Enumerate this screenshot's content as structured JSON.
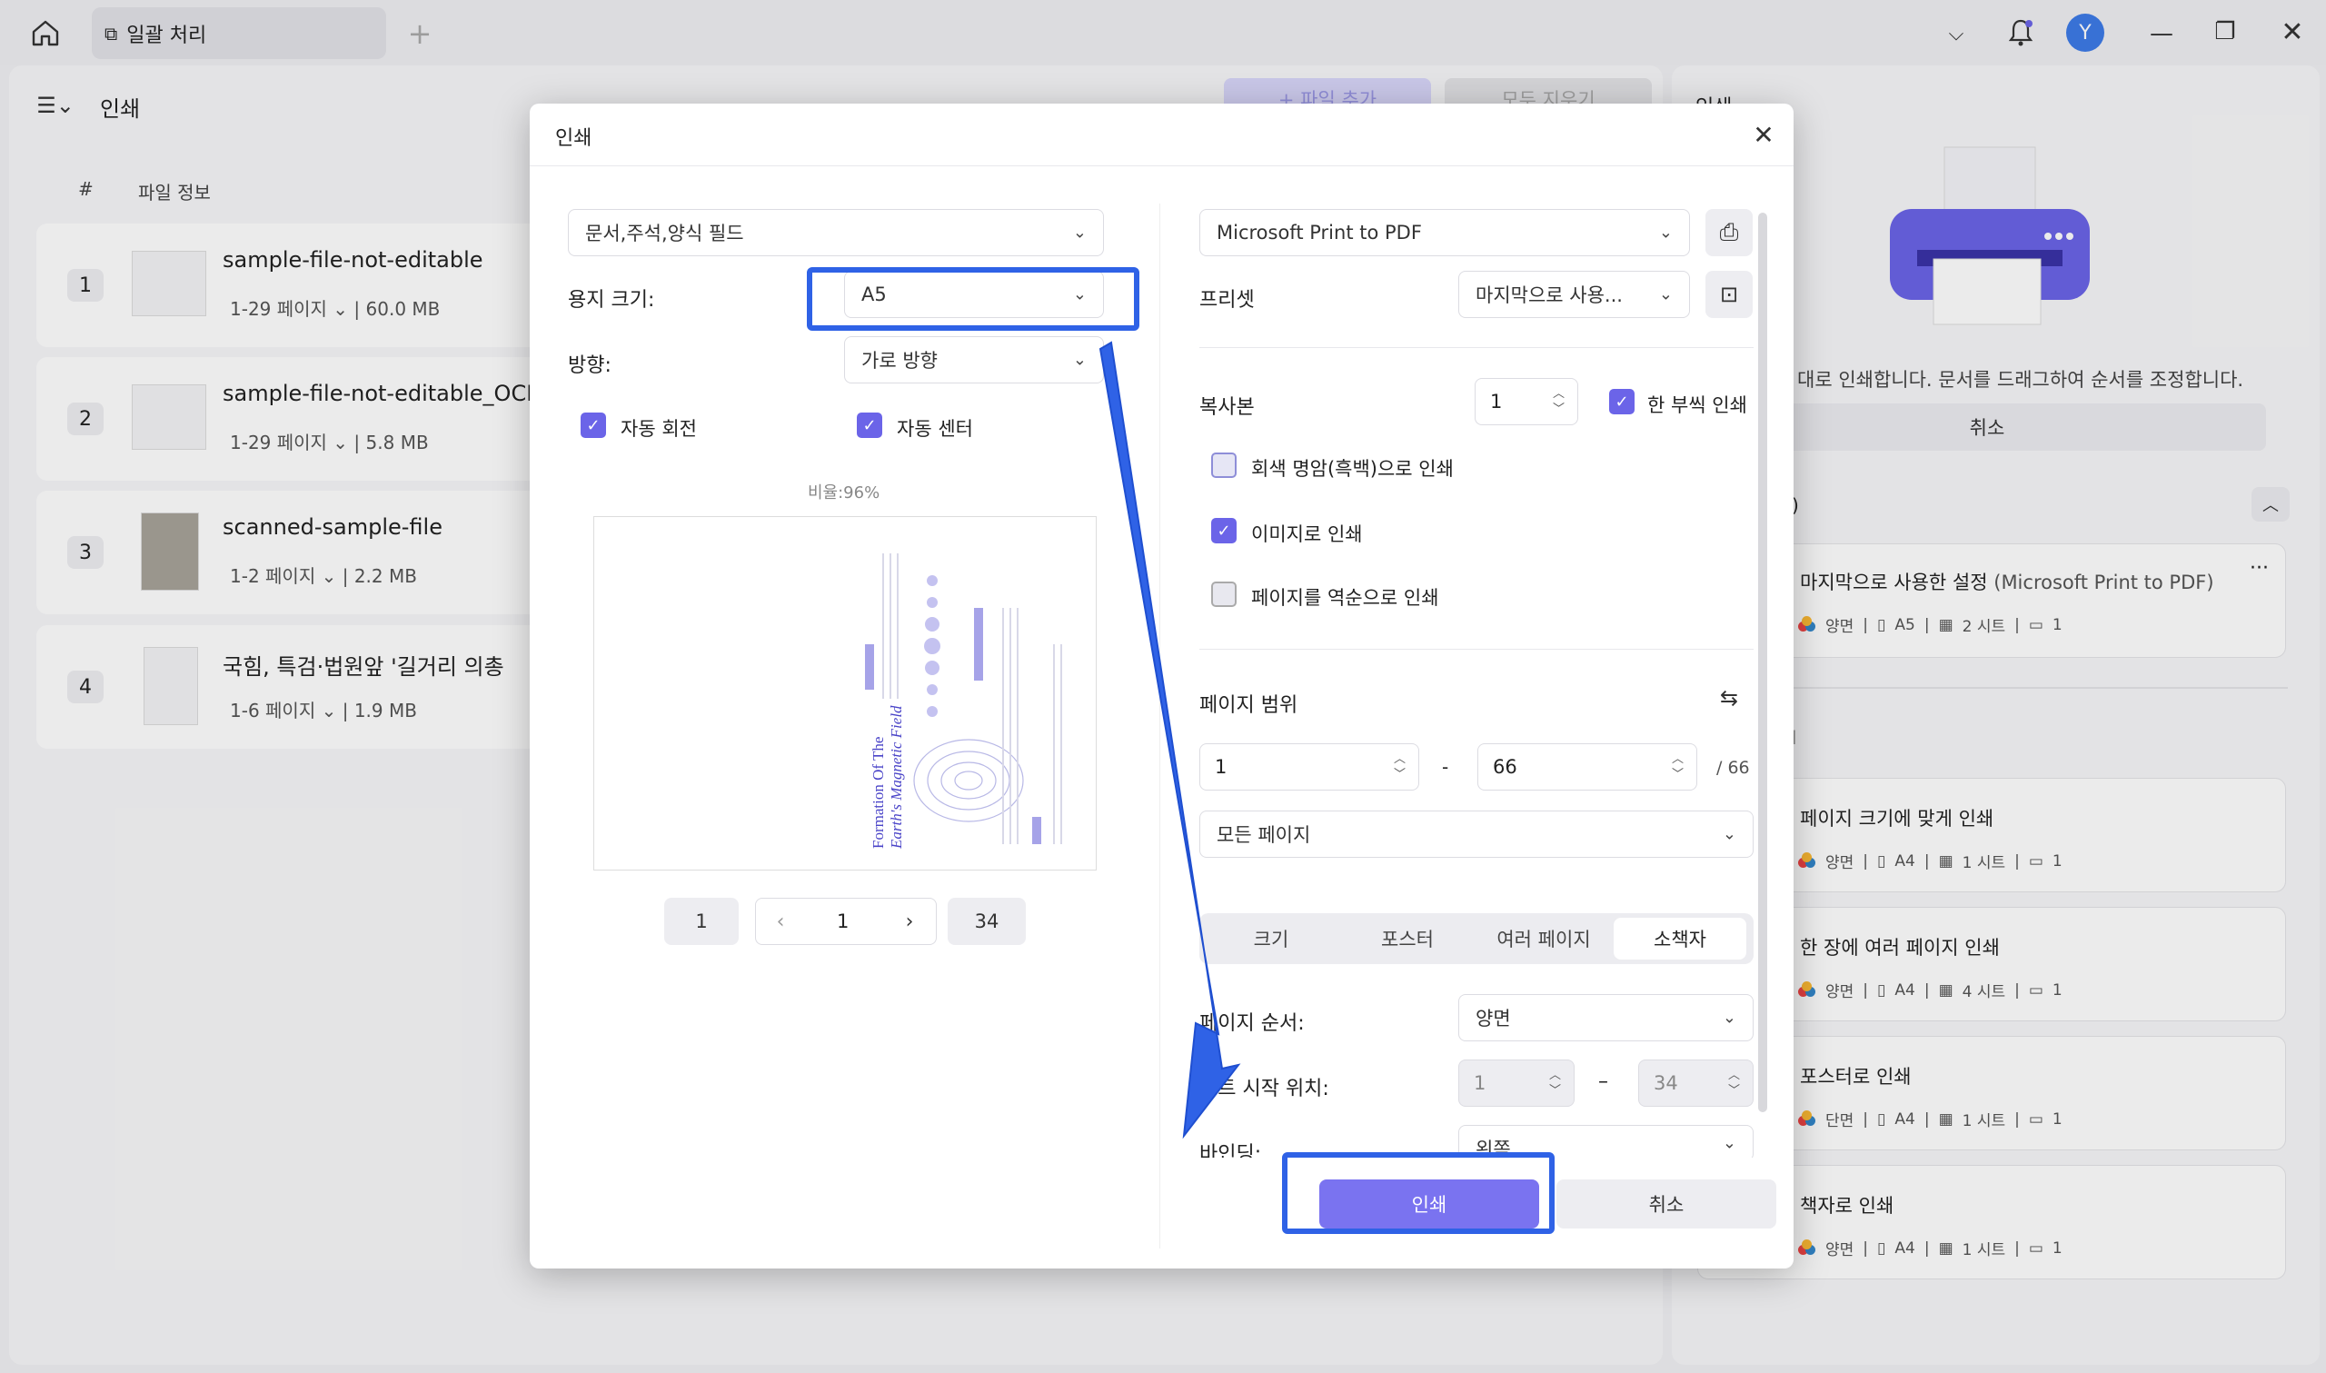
{
  "tab_title": "일괄 처리",
  "avatar_letter": "Y",
  "left_panel": {
    "header_title": "인쇄",
    "col_num": "#",
    "col_file": "파일 정보",
    "bg_button1": "+ 파일 추가",
    "bg_button2": "모두 지우기",
    "files": [
      {
        "num": "1",
        "name": "sample-file-not-editable",
        "pages": "1-29 페이지",
        "size": "60.0 MB"
      },
      {
        "num": "2",
        "name": "sample-file-not-editable_OCR",
        "pages": "1-29 페이지",
        "size": "5.8 MB"
      },
      {
        "num": "3",
        "name": "scanned-sample-file",
        "pages": "1-2 페이지",
        "size": "2.2 MB"
      },
      {
        "num": "4",
        "name": "국힘, 특검·법원앞 '길거리 의총",
        "pages": "1-6 페이지",
        "size": "1.9 MB"
      }
    ]
  },
  "right_panel": {
    "header": "인쇄",
    "info_text": "대로 인쇄합니다. 문서를 드래그하여 순서를 조정합니다.",
    "cancel": "취소",
    "section1_label": ")",
    "section2_label": "l",
    "cards": [
      {
        "title": "마지막으로 사용한 설정",
        "title_suffix": "(Microsoft Print to PDF)",
        "side": "양면",
        "paper": "A5",
        "sheets": "2 시트",
        "copies": "1"
      },
      {
        "title": "페이지 크기에 맞게 인쇄",
        "side": "양면",
        "paper": "A4",
        "sheets": "1 시트",
        "copies": "1"
      },
      {
        "title": "한 장에 여러 페이지 인쇄",
        "side": "양면",
        "paper": "A4",
        "sheets": "4 시트",
        "copies": "1"
      },
      {
        "title": "포스터로 인쇄",
        "side": "단면",
        "paper": "A4",
        "sheets": "1 시트",
        "copies": "1"
      },
      {
        "title": "책자로 인쇄",
        "side": "양면",
        "paper": "A4",
        "sheets": "1 시트",
        "copies": "1"
      }
    ]
  },
  "dialog": {
    "title": "인쇄",
    "content_select": "문서,주석,양식 필드",
    "paper_size_label": "용지 크기:",
    "paper_size": "A5",
    "orientation_label": "방향:",
    "orientation": "가로 방향",
    "auto_rotate": "자동 회전",
    "auto_center": "자동 센터",
    "scale": "비율:96%",
    "preview_title_line1": "Formation Of The",
    "preview_title_line2": "Earth's Magnetic Field",
    "pager": {
      "first": "1",
      "current": "1",
      "last": "34"
    },
    "printer": "Microsoft Print to PDF",
    "preset_label": "프리셋",
    "preset": "마지막으로 사용...",
    "copies_label": "복사본",
    "copies": "1",
    "collate": "한 부씩 인쇄",
    "grayscale": "회색 명암(흑백)으로 인쇄",
    "as_image": "이미지로 인쇄",
    "reverse": "페이지를 역순으로 인쇄",
    "page_range_label": "페이지 범위",
    "range_from": "1",
    "range_dash": "-",
    "range_to": "66",
    "range_total": "/ 66",
    "range_select": "모든 페이지",
    "modes": [
      "크기",
      "포스터",
      "여러 페이지",
      "소책자"
    ],
    "page_order_label": "페이지 순서:",
    "page_order": "양면",
    "sheet_start_label": "시트 시작 위치:",
    "sheet_from": "1",
    "sheet_dash": "–",
    "sheet_to": "34",
    "binding_label": "바인딩:",
    "binding": "왼쪽",
    "print_button": "인쇄",
    "cancel_button": "취소"
  },
  "colors": {
    "accent": "#6b64e8",
    "highlight": "#2f62e6",
    "print_button": "#7a73f0"
  }
}
